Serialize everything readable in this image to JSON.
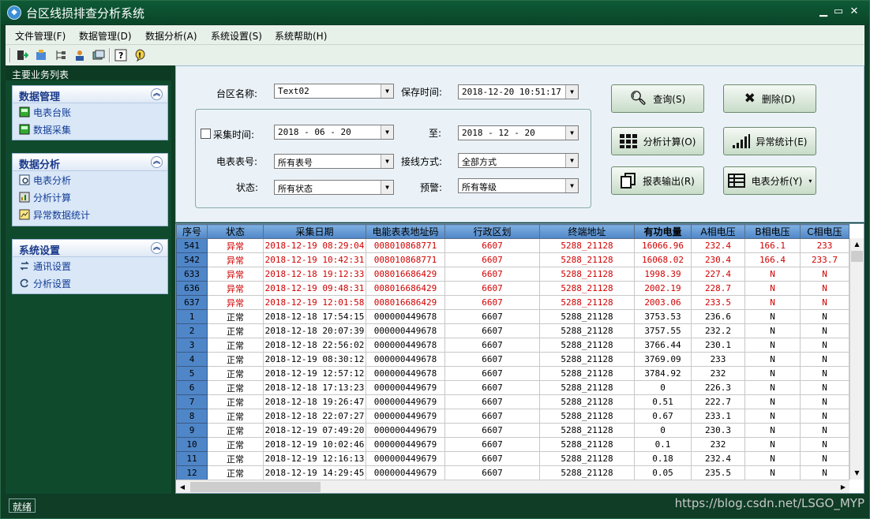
{
  "window": {
    "title": "台区线损排查分析系统"
  },
  "menu": [
    "文件管理(F)",
    "数据管理(D)",
    "数据分析(A)",
    "系统设置(S)",
    "系统帮助(H)"
  ],
  "sidebar": {
    "header": "主要业务列表",
    "groups": [
      {
        "title": "数据管理",
        "items": [
          "电表台账",
          "数据采集"
        ]
      },
      {
        "title": "数据分析",
        "items": [
          "电表分析",
          "分析计算",
          "异常数据统计"
        ]
      },
      {
        "title": "系统设置",
        "items": [
          "通讯设置",
          "分析设置"
        ]
      }
    ]
  },
  "filter": {
    "area_label": "台区名称:",
    "area_value": "Text02",
    "save_time_label": "保存时间:",
    "save_time_value": "2018-12-20 10:51:17",
    "collect_label": "采集时间:",
    "collect_from": "2018 - 06 - 20",
    "to_label": "至:",
    "collect_to": "2018 - 12 - 20",
    "meter_label": "电表表号:",
    "meter_value": "所有表号",
    "wiring_label": "接线方式:",
    "wiring_value": "全部方式",
    "state_label": "状态:",
    "state_value": "所有状态",
    "warn_label": "预警:",
    "warn_value": "所有等级"
  },
  "buttons": {
    "query": "查询(S)",
    "delete": "删除(D)",
    "calc": "分析计算(O)",
    "abnormal": "异常统计(E)",
    "export": "报表输出(R)",
    "meter_analysis": "电表分析(Y)"
  },
  "table": {
    "headers": [
      "序号",
      "状态",
      "采集日期",
      "电能表表地址码",
      "行政区划",
      "终端地址",
      "有功电量",
      "A相电压",
      "B相电压",
      "C相电压"
    ],
    "rows": [
      [
        "541",
        "异常",
        "2018-12-19 08:29:04",
        "008010868771",
        "6607",
        "5288_21128",
        "16066.96",
        "232.4",
        "166.1",
        "233"
      ],
      [
        "542",
        "异常",
        "2018-12-19 10:42:31",
        "008010868771",
        "6607",
        "5288_21128",
        "16068.02",
        "230.4",
        "166.4",
        "233.7"
      ],
      [
        "633",
        "异常",
        "2018-12-18 19:12:33",
        "008016686429",
        "6607",
        "5288_21128",
        "1998.39",
        "227.4",
        "N",
        "N"
      ],
      [
        "636",
        "异常",
        "2018-12-19 09:48:31",
        "008016686429",
        "6607",
        "5288_21128",
        "2002.19",
        "228.7",
        "N",
        "N"
      ],
      [
        "637",
        "异常",
        "2018-12-19 12:01:58",
        "008016686429",
        "6607",
        "5288_21128",
        "2003.06",
        "233.5",
        "N",
        "N"
      ],
      [
        "1",
        "正常",
        "2018-12-18 17:54:15",
        "000000449678",
        "6607",
        "5288_21128",
        "3753.53",
        "236.6",
        "N",
        "N"
      ],
      [
        "2",
        "正常",
        "2018-12-18 20:07:39",
        "000000449678",
        "6607",
        "5288_21128",
        "3757.55",
        "232.2",
        "N",
        "N"
      ],
      [
        "3",
        "正常",
        "2018-12-18 22:56:02",
        "000000449678",
        "6607",
        "5288_21128",
        "3766.44",
        "230.1",
        "N",
        "N"
      ],
      [
        "4",
        "正常",
        "2018-12-19 08:30:12",
        "000000449678",
        "6607",
        "5288_21128",
        "3769.09",
        "233",
        "N",
        "N"
      ],
      [
        "5",
        "正常",
        "2018-12-19 12:57:12",
        "000000449678",
        "6607",
        "5288_21128",
        "3784.92",
        "232",
        "N",
        "N"
      ],
      [
        "6",
        "正常",
        "2018-12-18 17:13:23",
        "000000449679",
        "6607",
        "5288_21128",
        "0",
        "226.3",
        "N",
        "N"
      ],
      [
        "7",
        "正常",
        "2018-12-18 19:26:47",
        "000000449679",
        "6607",
        "5288_21128",
        "0.51",
        "222.7",
        "N",
        "N"
      ],
      [
        "8",
        "正常",
        "2018-12-18 22:07:27",
        "000000449679",
        "6607",
        "5288_21128",
        "0.67",
        "233.1",
        "N",
        "N"
      ],
      [
        "9",
        "正常",
        "2018-12-19 07:49:20",
        "000000449679",
        "6607",
        "5288_21128",
        "0",
        "230.3",
        "N",
        "N"
      ],
      [
        "10",
        "正常",
        "2018-12-19 10:02:46",
        "000000449679",
        "6607",
        "5288_21128",
        "0.1",
        "232",
        "N",
        "N"
      ],
      [
        "11",
        "正常",
        "2018-12-19 12:16:13",
        "000000449679",
        "6607",
        "5288_21128",
        "0.18",
        "232.4",
        "N",
        "N"
      ],
      [
        "12",
        "正常",
        "2018-12-19 14:29:45",
        "000000449679",
        "6607",
        "5288_21128",
        "0.05",
        "235.5",
        "N",
        "N"
      ]
    ]
  },
  "status": "就绪",
  "watermark": "https://blog.csdn.net/LSGO_MYP"
}
